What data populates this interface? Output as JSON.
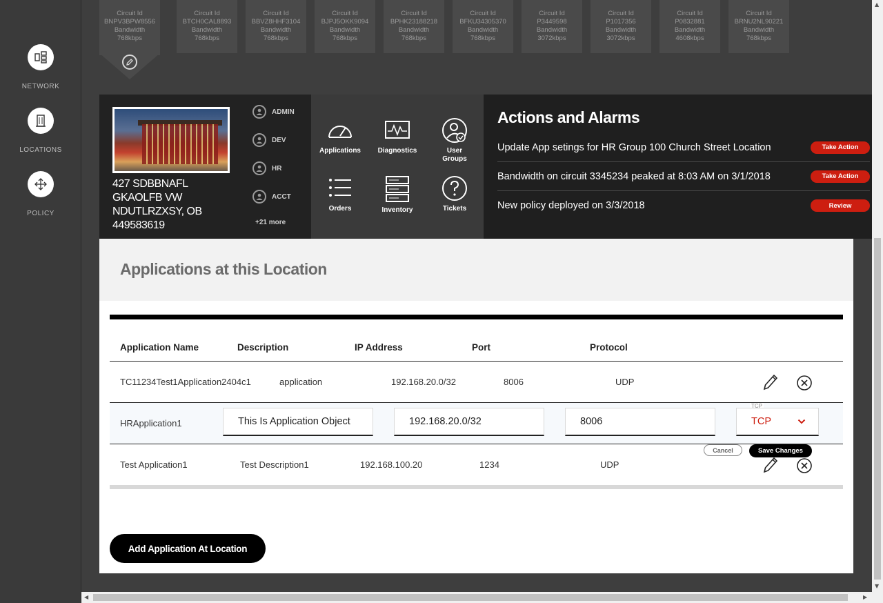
{
  "nav": {
    "items": [
      {
        "label": "NETWORK",
        "icon": "network-icon"
      },
      {
        "label": "LOCATIONS",
        "icon": "building-icon"
      },
      {
        "label": "POLICY",
        "icon": "move-icon"
      }
    ]
  },
  "circuits": [
    {
      "id_label": "Circuit Id",
      "id": "BNPV3BPW8556",
      "bw_label": "Bandwidth",
      "bw": "768kbps"
    },
    {
      "id_label": "Circuit Id",
      "id": "BTCH0CAL8893",
      "bw_label": "Bandwidth",
      "bw": "768kbps"
    },
    {
      "id_label": "Circuit Id",
      "id": "BBVZ8HHF3104",
      "bw_label": "Bandwidth",
      "bw": "768kbps"
    },
    {
      "id_label": "Circuit Id",
      "id": "BJPJ5OKK9094",
      "bw_label": "Bandwidth",
      "bw": "768kbps"
    },
    {
      "id_label": "Circuit Id",
      "id": "BPHK23188218",
      "bw_label": "Bandwidth",
      "bw": "768kbps"
    },
    {
      "id_label": "Circuit Id",
      "id": "BFKU34305370",
      "bw_label": "Bandwidth",
      "bw": "768kbps"
    },
    {
      "id_label": "Circuit Id",
      "id": "P3449598",
      "bw_label": "Bandwidth",
      "bw": "3072kbps"
    },
    {
      "id_label": "Circuit Id",
      "id": "P1017356",
      "bw_label": "Bandwidth",
      "bw": "3072kbps"
    },
    {
      "id_label": "Circuit Id",
      "id": "P0832881",
      "bw_label": "Bandwidth",
      "bw": "4608kbps"
    },
    {
      "id_label": "Circuit Id",
      "id": "BRNU2NL90221",
      "bw_label": "Bandwidth",
      "bw": "768kbps"
    }
  ],
  "location": {
    "address_lines": [
      "427 SDBBNAFL",
      "GKAOLFB VW",
      "NDUTLRZXSY, OB",
      "449583619"
    ],
    "groups": [
      "ADMIN",
      "DEV",
      "HR",
      "ACCT"
    ],
    "more_groups": "+21 more"
  },
  "tiles": {
    "applications": "Applications",
    "diagnostics": "Diagnostics",
    "user_groups": "User\nGroups",
    "orders": "Orders",
    "inventory": "Inventory",
    "tickets": "Tickets"
  },
  "actions": {
    "title": "Actions and Alarms",
    "alarms": [
      {
        "text": "Update App setings for HR Group 100 Church Street Location",
        "button": "Take Action"
      },
      {
        "text": "Bandwidth on circuit 3345234 peaked at 8:03 AM on 3/1/2018",
        "button": "Take Action"
      },
      {
        "text": "New policy deployed on 3/3/2018",
        "button": "Review"
      }
    ]
  },
  "apps": {
    "title": "Applications at this Location",
    "headers": {
      "name": "Application Name",
      "description": "Description",
      "ip": "IP Address",
      "port": "Port",
      "protocol": "Protocol"
    },
    "rows": [
      {
        "name": "TC11234Test1Application2404c1",
        "description": "application",
        "ip": "192.168.20.0/32",
        "port": "8006",
        "protocol": "UDP"
      },
      {
        "name": "HRApplication1",
        "description": "This Is Application Object",
        "ip": "192.168.20.0/32",
        "port": "8006",
        "protocol": "TCP",
        "protocol_float_label": "TCP"
      },
      {
        "name": "Test Application1",
        "description": "Test Description1",
        "ip": "192.168.100.20",
        "port": "1234",
        "protocol": "UDP"
      }
    ],
    "cancel_label": "Cancel",
    "save_label": "Save Changes",
    "add_button": "Add Application At Location"
  },
  "colors": {
    "accent_red": "#cd1e10",
    "dark_panel": "#1f1f1f"
  }
}
